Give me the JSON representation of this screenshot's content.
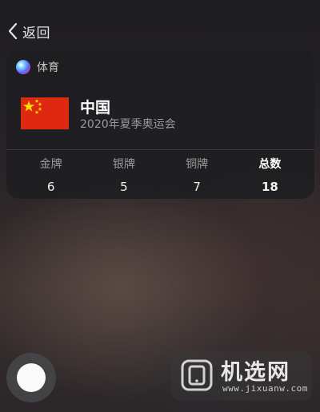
{
  "nav": {
    "back_label": "返回"
  },
  "card": {
    "category": "体育",
    "country": "中国",
    "event": "2020年夏季奥运会",
    "stats": [
      {
        "label": "金牌",
        "value": "6"
      },
      {
        "label": "银牌",
        "value": "5"
      },
      {
        "label": "铜牌",
        "value": "7"
      },
      {
        "label": "总数",
        "value": "18"
      }
    ]
  },
  "watermark": {
    "title": "机选网",
    "url": "www.jixuanw.com"
  },
  "colors": {
    "flag_red": "#de2910",
    "flag_star": "#ffde00"
  },
  "icons": [
    "chevron-left-icon",
    "siri-icon",
    "china-flag-icon",
    "record-button-icon",
    "watermark-logo-icon"
  ]
}
